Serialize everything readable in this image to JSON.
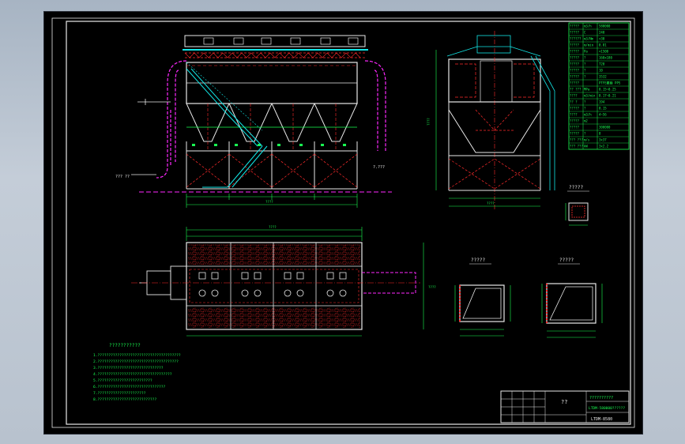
{
  "viewport": {
    "background": "#000000"
  },
  "colors": {
    "white": "#e8e8e8",
    "green": "#19ff52",
    "cyan": "#12e6e6",
    "magenta": "#ff28ff",
    "red": "#ff2b2b",
    "yellow": "#ffff33",
    "blue": "#6a8cff"
  },
  "spec_table": {
    "rows": [
      {
        "name": "?????",
        "unit": "m3/h",
        "value": "580000"
      },
      {
        "name": "?????",
        "unit": "C",
        "value": "240"
      },
      {
        "name": "??????",
        "unit": "m3/Nm",
        "value": "<30"
      },
      {
        "name": "?????",
        "unit": "m/min",
        "value": "0.81"
      },
      {
        "name": "?????",
        "unit": "Pa",
        "value": "<1500"
      },
      {
        "name": "?????",
        "unit": "?",
        "value": "168x180"
      },
      {
        "name": "?????",
        "unit": "?",
        "value": "720"
      },
      {
        "name": "?????",
        "unit": "?",
        "value": "10"
      },
      {
        "name": "?????",
        "unit": "?",
        "value": "3532"
      },
      {
        "name": "?????",
        "unit": "",
        "value": "PTFE覆膜 PPS"
      },
      {
        "name": "?? ???",
        "unit": "MPa",
        "value": "0.15~0.25"
      },
      {
        "name": "????",
        "unit": "m3/min",
        "value": "0.17~0.21"
      },
      {
        "name": "?? ?",
        "unit": "?",
        "value": "194"
      },
      {
        "name": "?????",
        "unit": "?",
        "value": "0.15"
      },
      {
        "name": "????",
        "unit": "m3/h",
        "value": "4~56"
      },
      {
        "name": "?????",
        "unit": "m2",
        "value": ""
      },
      {
        "name": "?????",
        "unit": "",
        "value": "300000"
      },
      {
        "name": "?????",
        "unit": "?",
        "value": "8"
      },
      {
        "name": "??? ???",
        "unit": "m/s",
        "value": "3x37"
      },
      {
        "name": "??? ???",
        "unit": "kW",
        "value": "3x2.2"
      }
    ]
  },
  "labels": {
    "inlet_flow": "??? ??",
    "outlet_flow": "??? ??",
    "detail_a_title": "?????",
    "detail_b_title": "?????",
    "detail_c_title": "?????",
    "notes_title": "???????????",
    "dim_total": "????",
    "dim_width": "????",
    "dim_plan_width": "????",
    "dim_height": "????",
    "dim_side_height": "????",
    "dim_side_width": "????",
    "el_label": "?.???"
  },
  "notes": {
    "lines": [
      "1.??????????????????????????????????????",
      "2.?????????????????????????????????????",
      "3.??????????????????????????????",
      "4.??????????????????????????????????",
      "5.?????????????????????????",
      "6.???????????????????????????????",
      "7.??????????????????????",
      "8.???????????????????????????"
    ]
  },
  "title_block": {
    "title": "??",
    "project": "??????????",
    "drawing_name": "LTDM-580000??????",
    "drawing_no": "LTDM-8580"
  }
}
